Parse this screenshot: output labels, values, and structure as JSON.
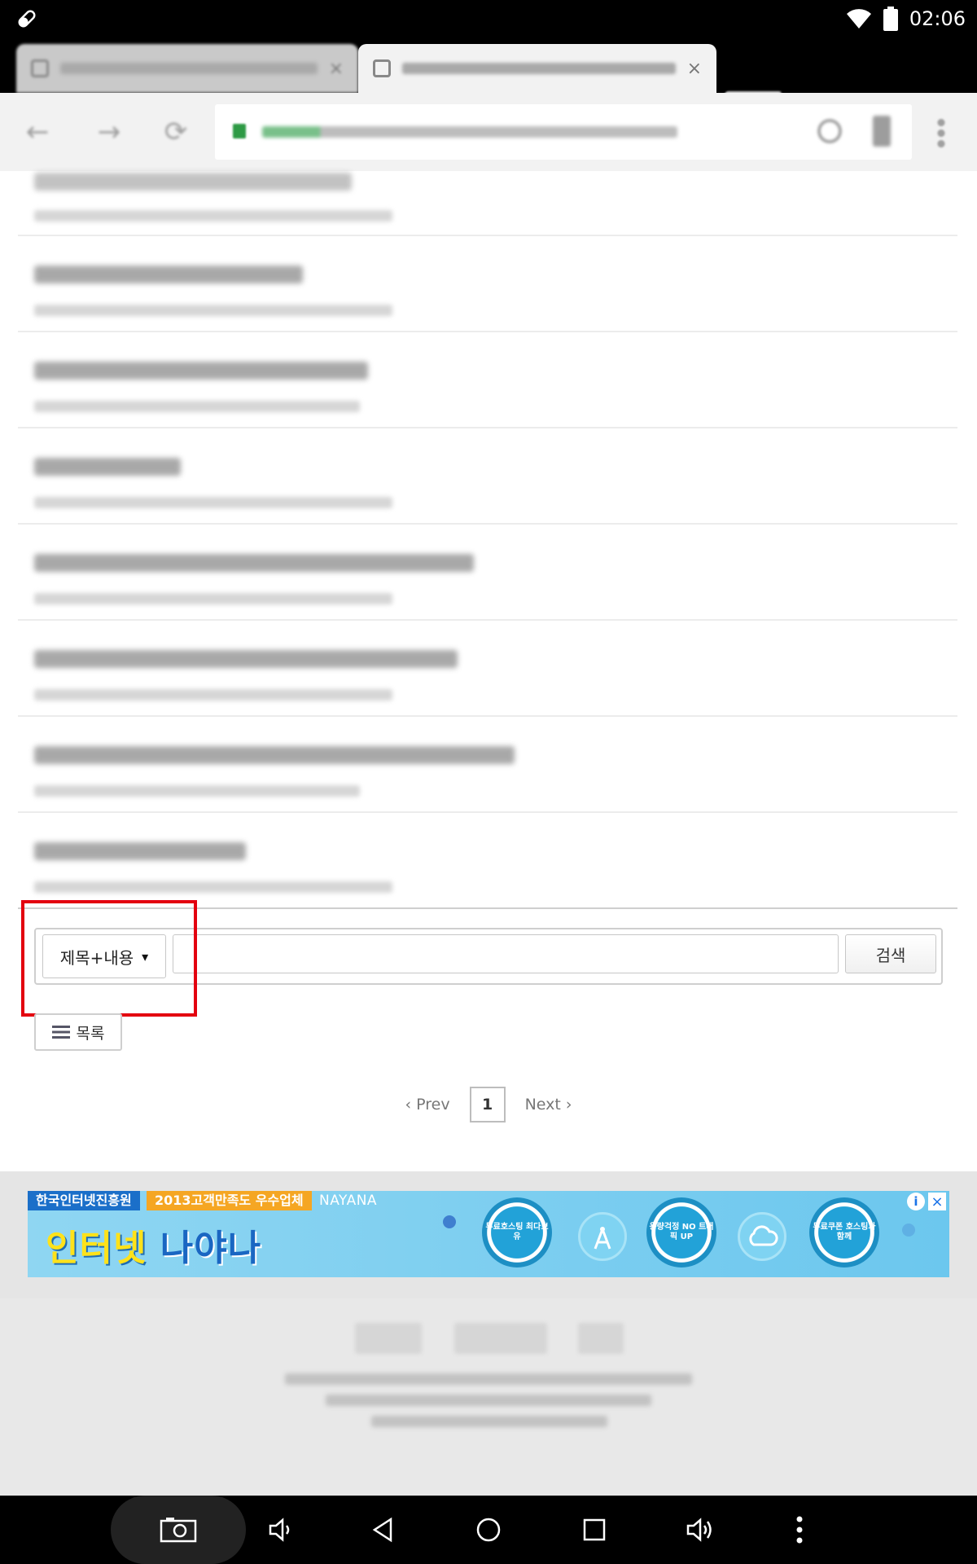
{
  "status_bar": {
    "time": "02:06",
    "icons": [
      "link-icon",
      "wifi-icon",
      "battery-icon"
    ]
  },
  "browser": {
    "tabs": [
      {
        "state": "inactive"
      },
      {
        "state": "active"
      }
    ]
  },
  "search": {
    "field_select": "제목+내용",
    "caret": "▾",
    "query_value": "",
    "button_label": "검색"
  },
  "list_button": {
    "label": "목록"
  },
  "pagination": {
    "prev": "‹ Prev",
    "current": "1",
    "next": "Next ›"
  },
  "ad": {
    "label_org": "한국인터넷진흥원",
    "label_award": "2013고객만족도 우수업체",
    "brand_small": "NAYANA",
    "headline_part1": "인터넷 ",
    "headline_part2": "나야나",
    "features": [
      "무료호스팅 최다보유",
      "용량걱정 NO 트래픽 UP",
      "무료쿠폰 호스팅과 함께"
    ],
    "info": "i",
    "close": "×"
  },
  "highlight_color": "#e3000f"
}
